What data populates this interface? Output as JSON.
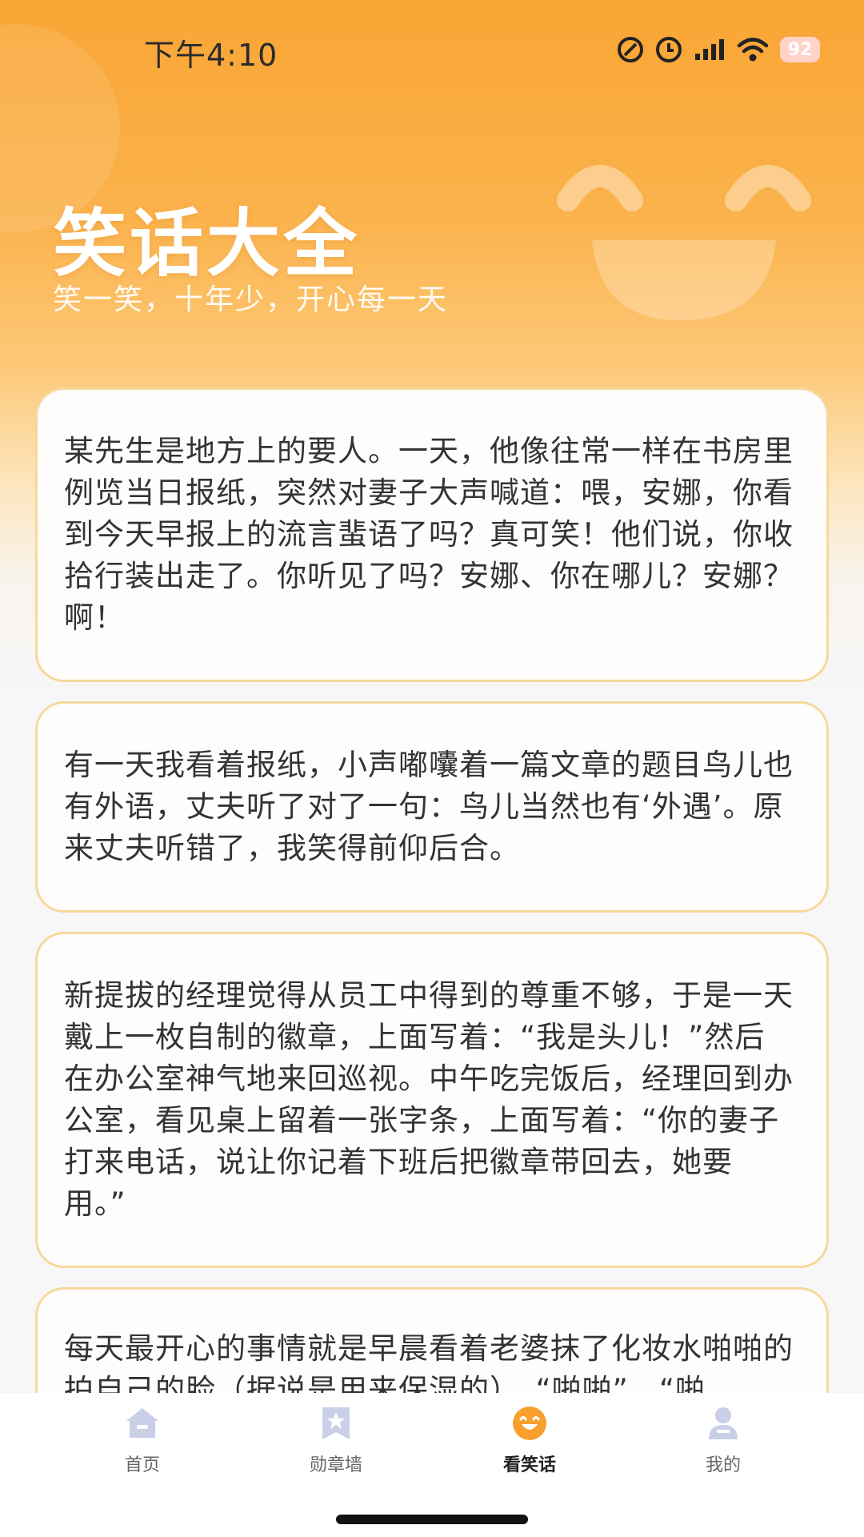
{
  "status_bar": {
    "time": "下午4:10",
    "battery": "92",
    "icons": [
      "do-not-disturb-icon",
      "alarm-icon",
      "signal-icon",
      "wifi-icon",
      "battery-icon"
    ]
  },
  "header": {
    "title": "笑话大全",
    "subtitle": "笑一笑，十年少，开心每一天"
  },
  "jokes": [
    "某先生是地方上的要人。一天，他像往常一样在书房里例览当日报纸，突然对妻子大声喊道：喂，安娜，你看到今天早报上的流言蜚语了吗？真可笑！他们说，你收拾行装出走了。你听见了吗？安娜、你在哪儿？安娜？啊！",
    "有一天我看着报纸，小声嘟囔着一篇文章的题目鸟儿也有外语，丈夫听了对了一句：鸟儿当然也有‘外遇’。原来丈夫听错了，我笑得前仰后合。",
    "新提拔的经理觉得从员工中得到的尊重不够，于是一天戴上一枚自制的徽章，上面写着：“我是头儿！”然后在办公室神气地来回巡视。中午吃完饭后，经理回到办公室，看见桌上留着一张字条，上面写着：“你的妻子打来电话，说让你记着下班后把徽章带回去，她要用。”",
    "每天最开心的事情就是早晨看着老婆抹了化妆水啪啪的拍自己的脸（据说是用来保湿的），“啪啪”，“啪"
  ],
  "tab_bar": {
    "active": "看笑话",
    "tabs": [
      {
        "label": "首页",
        "icon": "home-icon"
      },
      {
        "label": "勋章墙",
        "icon": "badge-icon"
      },
      {
        "label": "看笑话",
        "icon": "laugh-face-icon"
      },
      {
        "label": "我的",
        "icon": "user-icon"
      }
    ]
  },
  "colors": {
    "header_orange": "#f9a534",
    "card_border": "#f6d89a",
    "active_tab": "#f7a02f",
    "inactive_tab": "#c9cfe6"
  }
}
